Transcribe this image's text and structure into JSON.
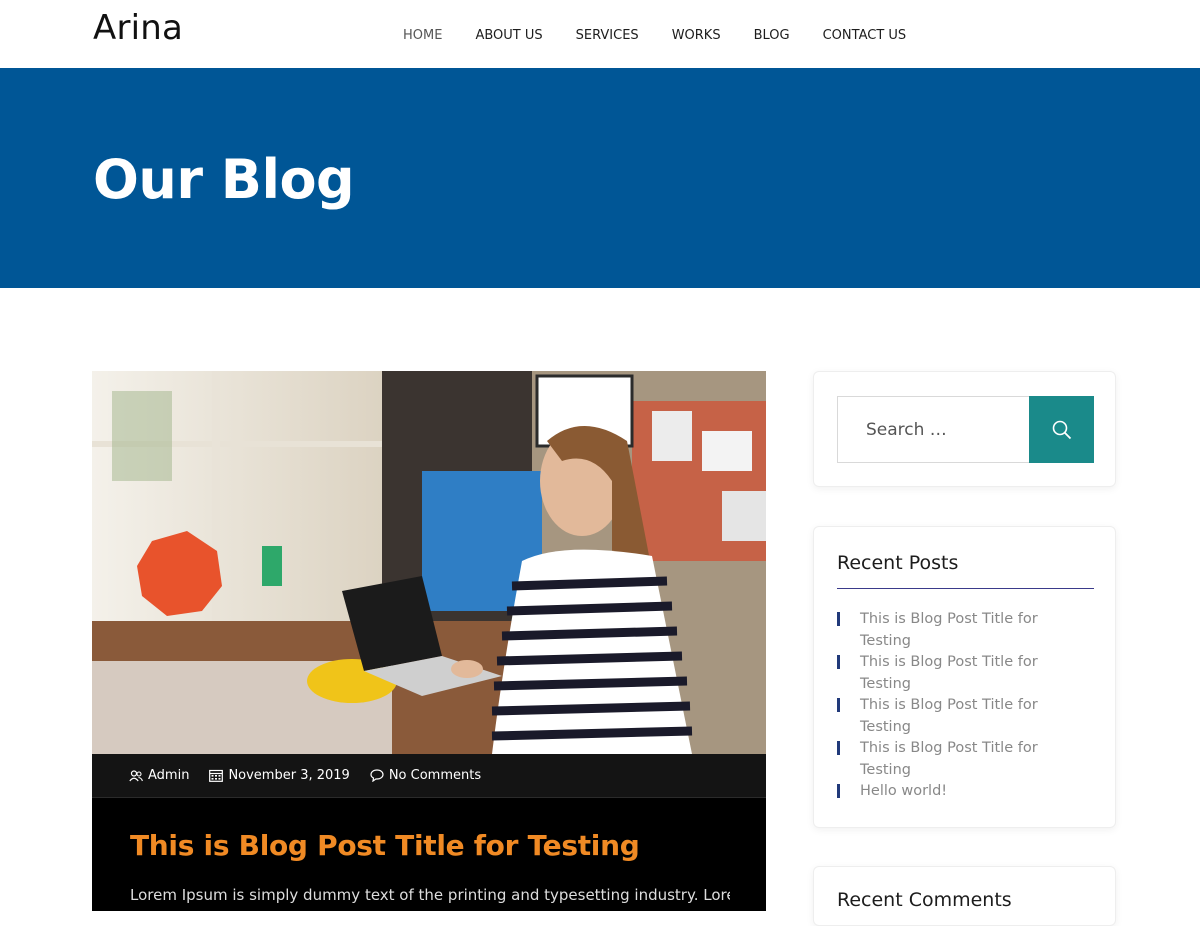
{
  "site": {
    "logo": "Arina"
  },
  "nav": {
    "items": [
      {
        "label": "HOME"
      },
      {
        "label": "ABOUT US"
      },
      {
        "label": "SERVICES"
      },
      {
        "label": "WORKS"
      },
      {
        "label": "BLOG"
      },
      {
        "label": "CONTACT US"
      }
    ]
  },
  "banner": {
    "title": "Our Blog",
    "background": "#005696"
  },
  "post": {
    "meta": {
      "author": "Admin",
      "date": "November 3, 2019",
      "comments": "No Comments"
    },
    "title": "This is Blog Post Title for Testing",
    "excerpt": "Lorem Ipsum is simply dummy text of the printing and typesetting industry. Lorem",
    "title_color": "#f08a24",
    "image_icon": "woman-at-laptop-photo"
  },
  "sidebar": {
    "search": {
      "placeholder": "Search …",
      "button_icon": "search-icon",
      "button_color": "#1a8a8a"
    },
    "recent_posts": {
      "title": "Recent Posts",
      "items": [
        {
          "label": "This is Blog Post Title for Testing"
        },
        {
          "label": "This is Blog Post Title for Testing"
        },
        {
          "label": "This is Blog Post Title for Testing"
        },
        {
          "label": "This is Blog Post Title for Testing"
        },
        {
          "label": "Hello world!"
        }
      ]
    },
    "recent_comments": {
      "title": "Recent Comments"
    }
  }
}
